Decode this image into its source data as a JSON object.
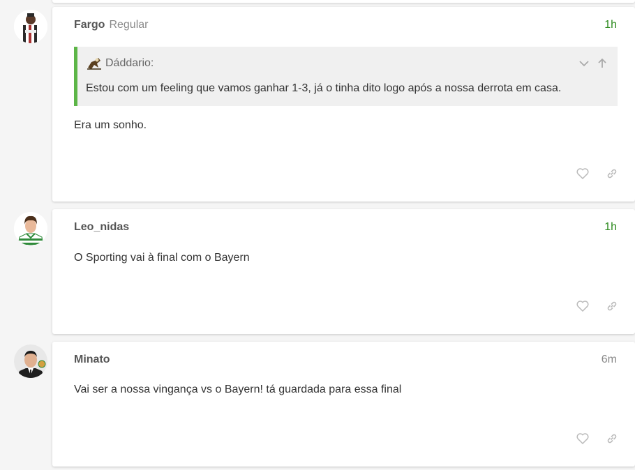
{
  "posts": [
    {
      "username": "Fargo",
      "user_title": "Regular",
      "time": "1h",
      "quote": {
        "author": "Dáddario:",
        "text": "Estou com um feeling que vamos ganhar 1-3, já o tinha dito logo após a nossa derrota em casa."
      },
      "body": "Era um sonho.",
      "avatar_icon": "avatar-striped-shirt",
      "like_icon": "heart-icon",
      "link_icon": "link-icon"
    },
    {
      "username": "Leo_nidas",
      "time": "1h",
      "body": "O Sporting vai à final com o Bayern",
      "avatar_icon": "avatar-green-kit",
      "like_icon": "heart-icon",
      "link_icon": "link-icon"
    },
    {
      "username": "Minato",
      "time": "6m",
      "body": "Vai ser a nossa vingança vs o Bayern! tá guardada para essa final",
      "avatar_icon": "avatar-suit",
      "like_icon": "heart-icon",
      "link_icon": "link-icon"
    }
  ],
  "colors": {
    "background": "#f5f5f5",
    "quote_border": "#5cb547",
    "time_recent": "#2e8b1f",
    "time_old": "#888888"
  }
}
